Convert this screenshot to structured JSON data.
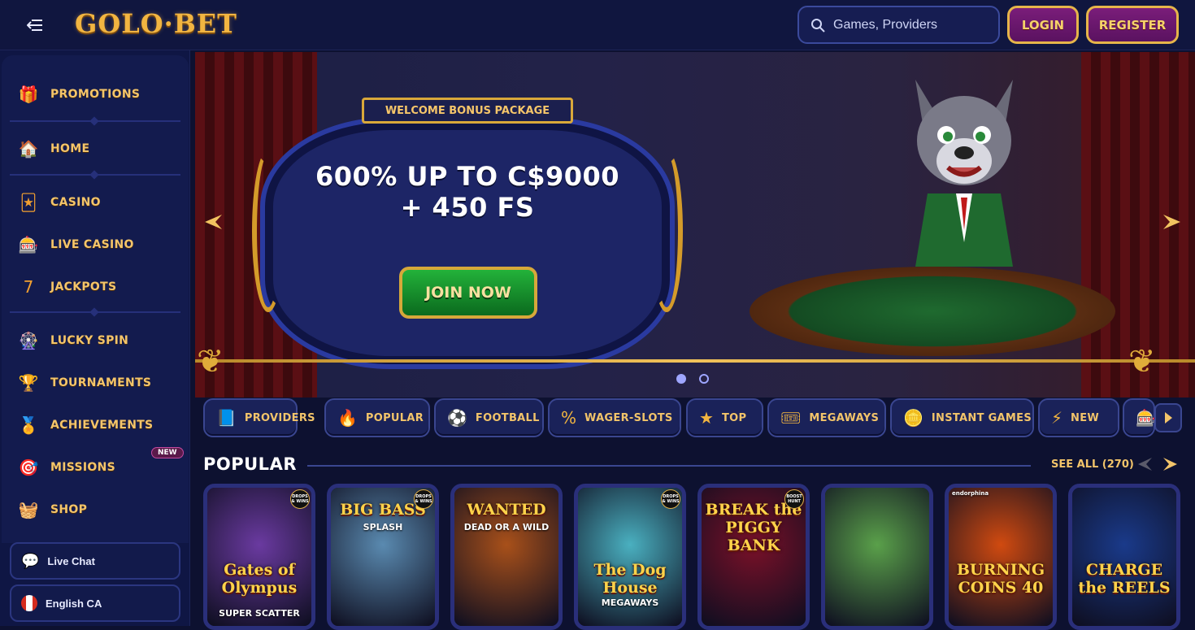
{
  "header": {
    "logo_text": "GOLO·BET",
    "search_placeholder": "Games, Providers",
    "login_label": "LOGIN",
    "register_label": "REGISTER"
  },
  "sidebar": {
    "items": [
      {
        "label": "PROMOTIONS",
        "icon": "gift-icon"
      },
      {
        "label": "HOME",
        "icon": "house-icon"
      },
      {
        "label": "CASINO",
        "icon": "cards-icon"
      },
      {
        "label": "LIVE CASINO",
        "icon": "chips-icon"
      },
      {
        "label": "JACKPOTS",
        "icon": "slot-777-icon"
      },
      {
        "label": "LUCKY SPIN",
        "icon": "wheel-icon"
      },
      {
        "label": "TOURNAMENTS",
        "icon": "trophy-icon"
      },
      {
        "label": "ACHIEVEMENTS",
        "icon": "medal-icon"
      },
      {
        "label": "MISSIONS",
        "icon": "target-icon"
      },
      {
        "label": "SHOP",
        "icon": "basket-icon"
      }
    ],
    "new_badge": "NEW",
    "live_chat_label": "Live Chat",
    "language_label": "English CA"
  },
  "banner": {
    "tag": "WELCOME BONUS PACKAGE",
    "title": "600% UP TO C$9000 + 450 FS",
    "cta": "JOIN NOW",
    "slides": 2,
    "active_slide": 1
  },
  "categories": [
    {
      "label": "PROVIDERS",
      "icon": "book-icon"
    },
    {
      "label": "POPULAR",
      "icon": "fire-icon"
    },
    {
      "label": "FOOTBALL",
      "icon": "football-icon"
    },
    {
      "label": "WAGER-SLOTS",
      "icon": "percent-icon"
    },
    {
      "label": "TOP",
      "icon": "star-icon"
    },
    {
      "label": "MEGAWAYS",
      "icon": "ticket-icon"
    },
    {
      "label": "INSTANT GAMES",
      "icon": "coin-icon"
    },
    {
      "label": "NEW",
      "icon": "lightning-icon"
    }
  ],
  "popular": {
    "title": "POPULAR",
    "see_all": "SEE ALL (270)",
    "games": [
      {
        "name": "Gates of Olympus",
        "sub": "SUPER SCATTER",
        "badge": "DROPS & WINS",
        "color": "#6a3aa0"
      },
      {
        "name": "BIG BASS",
        "sub": "SPLASH",
        "badge": "DROPS & WINS",
        "color": "#5a8ab0"
      },
      {
        "name": "WANTED",
        "sub": "DEAD OR A WILD",
        "badge": "",
        "color": "#a8501a"
      },
      {
        "name": "The Dog House",
        "sub": "MEGAWAYS",
        "badge": "DROPS & WINS",
        "color": "#4ab0c0"
      },
      {
        "name": "BREAK the PIGGY BANK",
        "sub": "",
        "badge": "BOOST HUNT",
        "color": "#7a1028"
      },
      {
        "name": "",
        "sub": "",
        "badge": "",
        "color": "#5aa04a"
      },
      {
        "name": "BURNING COINS 40",
        "sub": "",
        "badge": "",
        "color": "#d04a10"
      },
      {
        "name": "CHARGE the REELS",
        "sub": "",
        "badge": "",
        "color": "#1a3a8a"
      }
    ],
    "provider_label": "endorphina"
  }
}
